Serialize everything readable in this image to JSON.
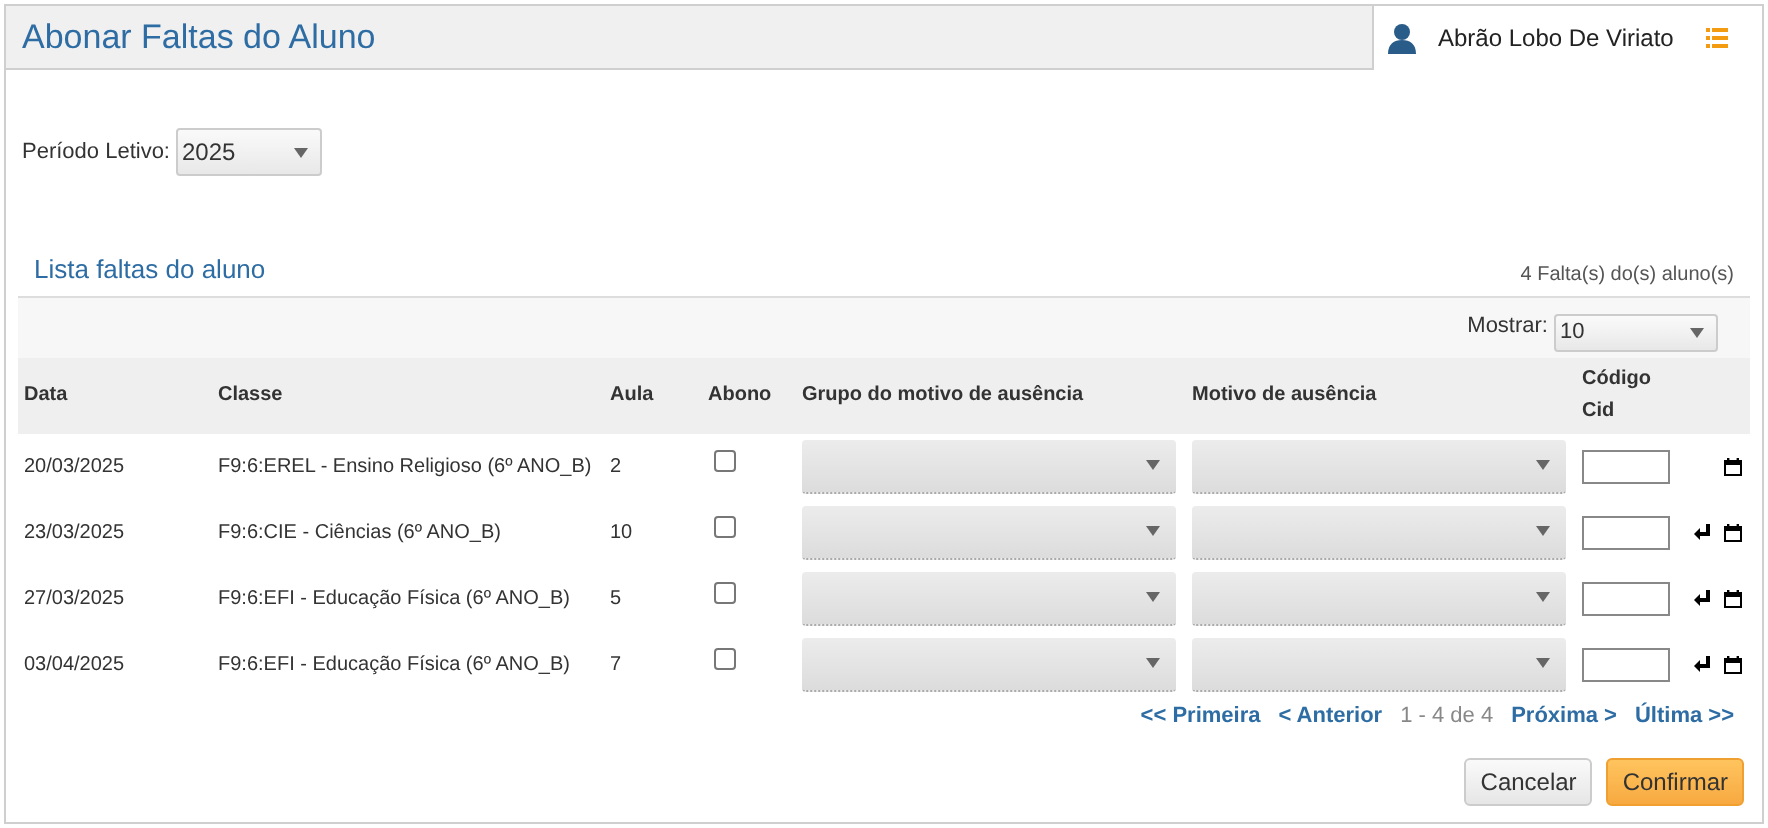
{
  "header": {
    "title": "Abonar Faltas do Aluno",
    "user": "Abrão Lobo De Viriato"
  },
  "period": {
    "label": "Período Letivo:",
    "value": "2025"
  },
  "list": {
    "title": "Lista faltas do aluno",
    "count": "4 Falta(s) do(s) aluno(s)",
    "show_label": "Mostrar:",
    "show_value": "10",
    "columns": [
      "Data",
      "Classe",
      "Aula",
      "Abono",
      "Grupo do motivo de ausência",
      "Motivo de ausência",
      "Código Cid"
    ],
    "rows": [
      {
        "date": "20/03/2025",
        "class": "F9:6:EREL - Ensino Religioso (6º ANO_B)",
        "lesson": "2",
        "checked": false,
        "return_icon": false
      },
      {
        "date": "23/03/2025",
        "class": "F9:6:CIE - Ciências (6º ANO_B)",
        "lesson": "10",
        "checked": false,
        "return_icon": true
      },
      {
        "date": "27/03/2025",
        "class": "F9:6:EFI - Educação Física (6º ANO_B)",
        "lesson": "5",
        "checked": false,
        "return_icon": true
      },
      {
        "date": "03/04/2025",
        "class": "F9:6:EFI - Educação Física (6º ANO_B)",
        "lesson": "7",
        "checked": false,
        "return_icon": true
      }
    ],
    "pager": {
      "first": "<< Primeira",
      "prev": "< Anterior",
      "range": "1 - 4 de 4",
      "next": "Próxima >",
      "last": "Última >>"
    }
  },
  "buttons": [
    {
      "label": "Cancelar",
      "kind": "secondary"
    },
    {
      "label": "Confirmar",
      "kind": "primary"
    }
  ]
}
